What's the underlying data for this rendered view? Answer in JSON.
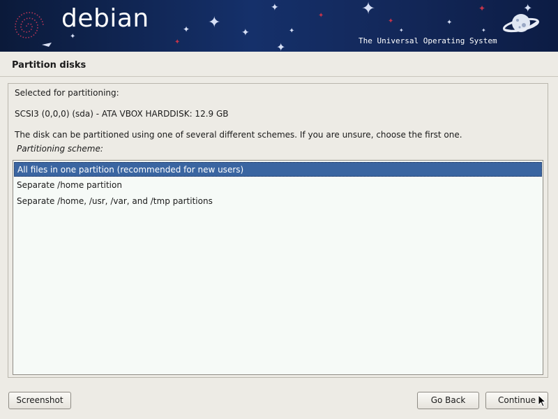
{
  "banner": {
    "logo_text": "debian",
    "tagline": "The Universal Operating System"
  },
  "page": {
    "title": "Partition disks"
  },
  "content": {
    "selected_label": "Selected for partitioning:",
    "disk": "SCSI3 (0,0,0) (sda) - ATA VBOX HARDDISK: 12.9 GB",
    "description": "The disk can be partitioned using one of several different schemes. If you are unsure, choose the first one.",
    "scheme_label": "Partitioning scheme:"
  },
  "schemes": [
    {
      "label": "All files in one partition (recommended for new users)",
      "selected": true
    },
    {
      "label": "Separate /home partition",
      "selected": false
    },
    {
      "label": "Separate /home, /usr, /var, and /tmp partitions",
      "selected": false
    }
  ],
  "buttons": {
    "screenshot": "Screenshot",
    "go_back": "Go Back",
    "continue": "Continue"
  },
  "colors": {
    "selection": "#3a65a1",
    "banner": "#15306a",
    "background": "#edebe5"
  }
}
